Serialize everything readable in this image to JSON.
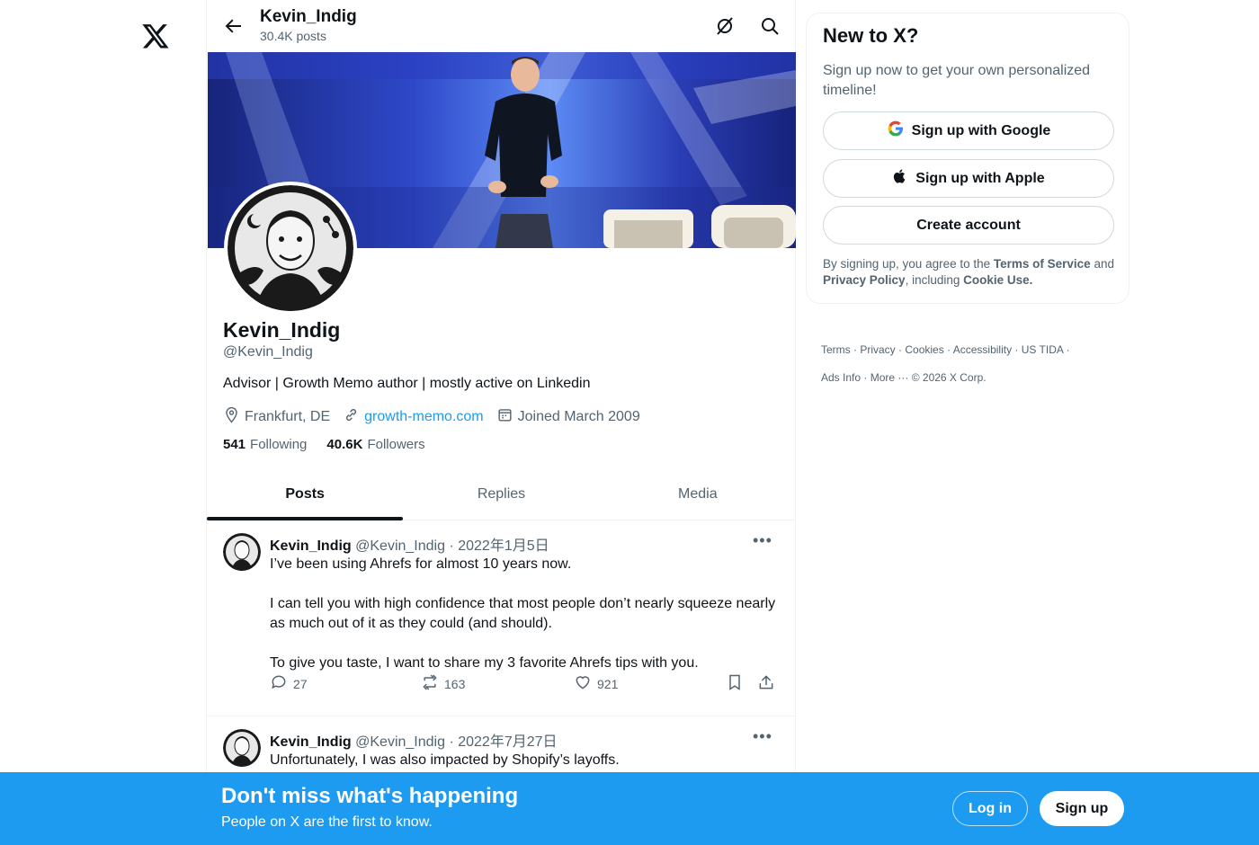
{
  "topbar": {
    "title": "Kevin_Indig",
    "posts_count": "30.4K posts"
  },
  "profile": {
    "name": "Kevin_Indig",
    "handle": "@Kevin_Indig",
    "bio": "Advisor | Growth Memo author | mostly active on Linkedin",
    "location": "Frankfurt, DE",
    "website": "growth-memo.com",
    "joined": "Joined March 2009",
    "following_count": "541",
    "following_label": "Following",
    "followers_count": "40.6K",
    "followers_label": "Followers"
  },
  "tabs": [
    {
      "label": "Posts",
      "active": true
    },
    {
      "label": "Replies",
      "active": false
    },
    {
      "label": "Media",
      "active": false
    }
  ],
  "posts": [
    {
      "name": "Kevin_Indig",
      "handle": "@Kevin_Indig",
      "date": "· 2022年1月5日",
      "text": "I’ve been using Ahrefs for almost 10 years now.\n\nI can tell you with high confidence that most people don’t nearly squeeze nearly as much out of it as they could (and should).\n\nTo give you taste, I want to share my 3 favorite Ahrefs tips with you.",
      "replies": "27",
      "reposts": "163",
      "likes": "921"
    },
    {
      "name": "Kevin_Indig",
      "handle": "@Kevin_Indig",
      "date": "· 2022年7月27日",
      "text": "Unfortunately, I was also impacted by Shopify’s layoffs."
    }
  ],
  "sidebar": {
    "heading": "New to X?",
    "subtitle": "Sign up now to get your own personalized timeline!",
    "google_label": "Sign up with Google",
    "apple_label": "Sign up with Apple",
    "create_label": "Create account",
    "legal_prefix": "By signing up, you agree to the ",
    "tos": "Terms of Service",
    "legal_and": " and ",
    "privacy": "Privacy Policy",
    "legal_including": ", including ",
    "cookie": "Cookie Use."
  },
  "footer_links": {
    "terms": "Terms",
    "privacy": "Privacy",
    "cookies": "Cookies",
    "accessibility": "Accessibility",
    "us_tida": "US TIDA",
    "ads_info": "Ads Info",
    "more": "More ···",
    "copyright": "© 2026 X Corp."
  },
  "bottom_bar": {
    "title": "Don't miss what's happening",
    "subtitle": "People on X are the first to know.",
    "login": "Log in",
    "signup": "Sign up"
  },
  "colors": {
    "accent": "#1d9bf0",
    "text": "#0f1419",
    "muted": "#536471"
  }
}
